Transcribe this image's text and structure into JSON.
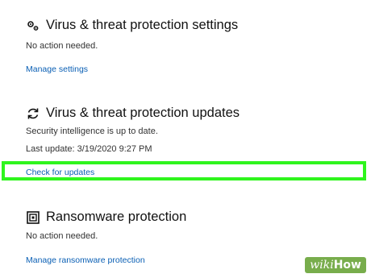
{
  "settings_section": {
    "title": "Virus & threat protection settings",
    "status": "No action needed.",
    "link": "Manage settings",
    "icon": "gear-shield-icon"
  },
  "updates_section": {
    "title": "Virus & threat protection updates",
    "status": "Security intelligence is up to date.",
    "last_update": "Last update: 3/19/2020 9:27 PM",
    "link": "Check for updates",
    "icon": "refresh-icon"
  },
  "ransomware_section": {
    "title": "Ransomware protection",
    "status": "No action needed.",
    "link": "Manage ransomware protection",
    "icon": "ransomware-icon"
  },
  "watermark": {
    "wiki": "wiki",
    "how": "How"
  },
  "colors": {
    "link": "#0a5fb4",
    "highlight": "#2ff51d"
  }
}
